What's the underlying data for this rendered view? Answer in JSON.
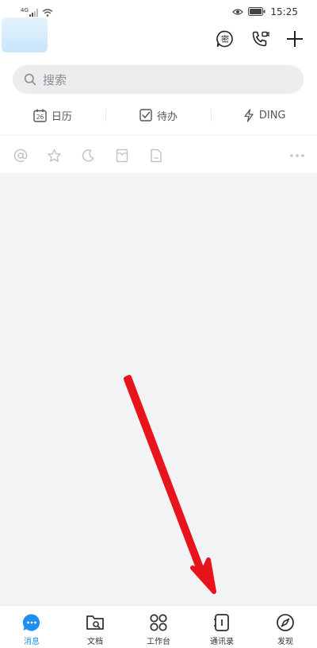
{
  "status_bar": {
    "network": "4G",
    "time": "15:25"
  },
  "header": {
    "actions": [
      {
        "name": "secret-chat",
        "icon": "secret-chat-icon",
        "glyph": "密"
      },
      {
        "name": "call",
        "icon": "phone-call-icon"
      },
      {
        "name": "add",
        "icon": "plus-icon"
      }
    ]
  },
  "search": {
    "placeholder": "搜索"
  },
  "shortcuts": [
    {
      "label": "日历",
      "icon": "calendar-icon",
      "badge": "26"
    },
    {
      "label": "待办",
      "icon": "checkbox-icon"
    },
    {
      "label": "DING",
      "icon": "lightning-icon"
    }
  ],
  "filters": [
    {
      "icon": "at-icon"
    },
    {
      "icon": "star-icon"
    },
    {
      "icon": "moon-icon"
    },
    {
      "icon": "inbox-icon"
    },
    {
      "icon": "document-icon"
    },
    {
      "icon": "more-icon"
    }
  ],
  "tab_bar": {
    "tabs": [
      {
        "label": "消息",
        "icon": "chat-bubble-icon",
        "active": true
      },
      {
        "label": "文档",
        "icon": "folder-icon",
        "active": false
      },
      {
        "label": "工作台",
        "icon": "grid-icon",
        "active": false
      },
      {
        "label": "通讯录",
        "icon": "contacts-book-icon",
        "active": false
      },
      {
        "label": "发现",
        "icon": "compass-icon",
        "active": false
      }
    ]
  },
  "colors": {
    "accent": "#1f8ff0",
    "content_bg": "#f2f3f5",
    "annotation_arrow": "#e8141c"
  }
}
